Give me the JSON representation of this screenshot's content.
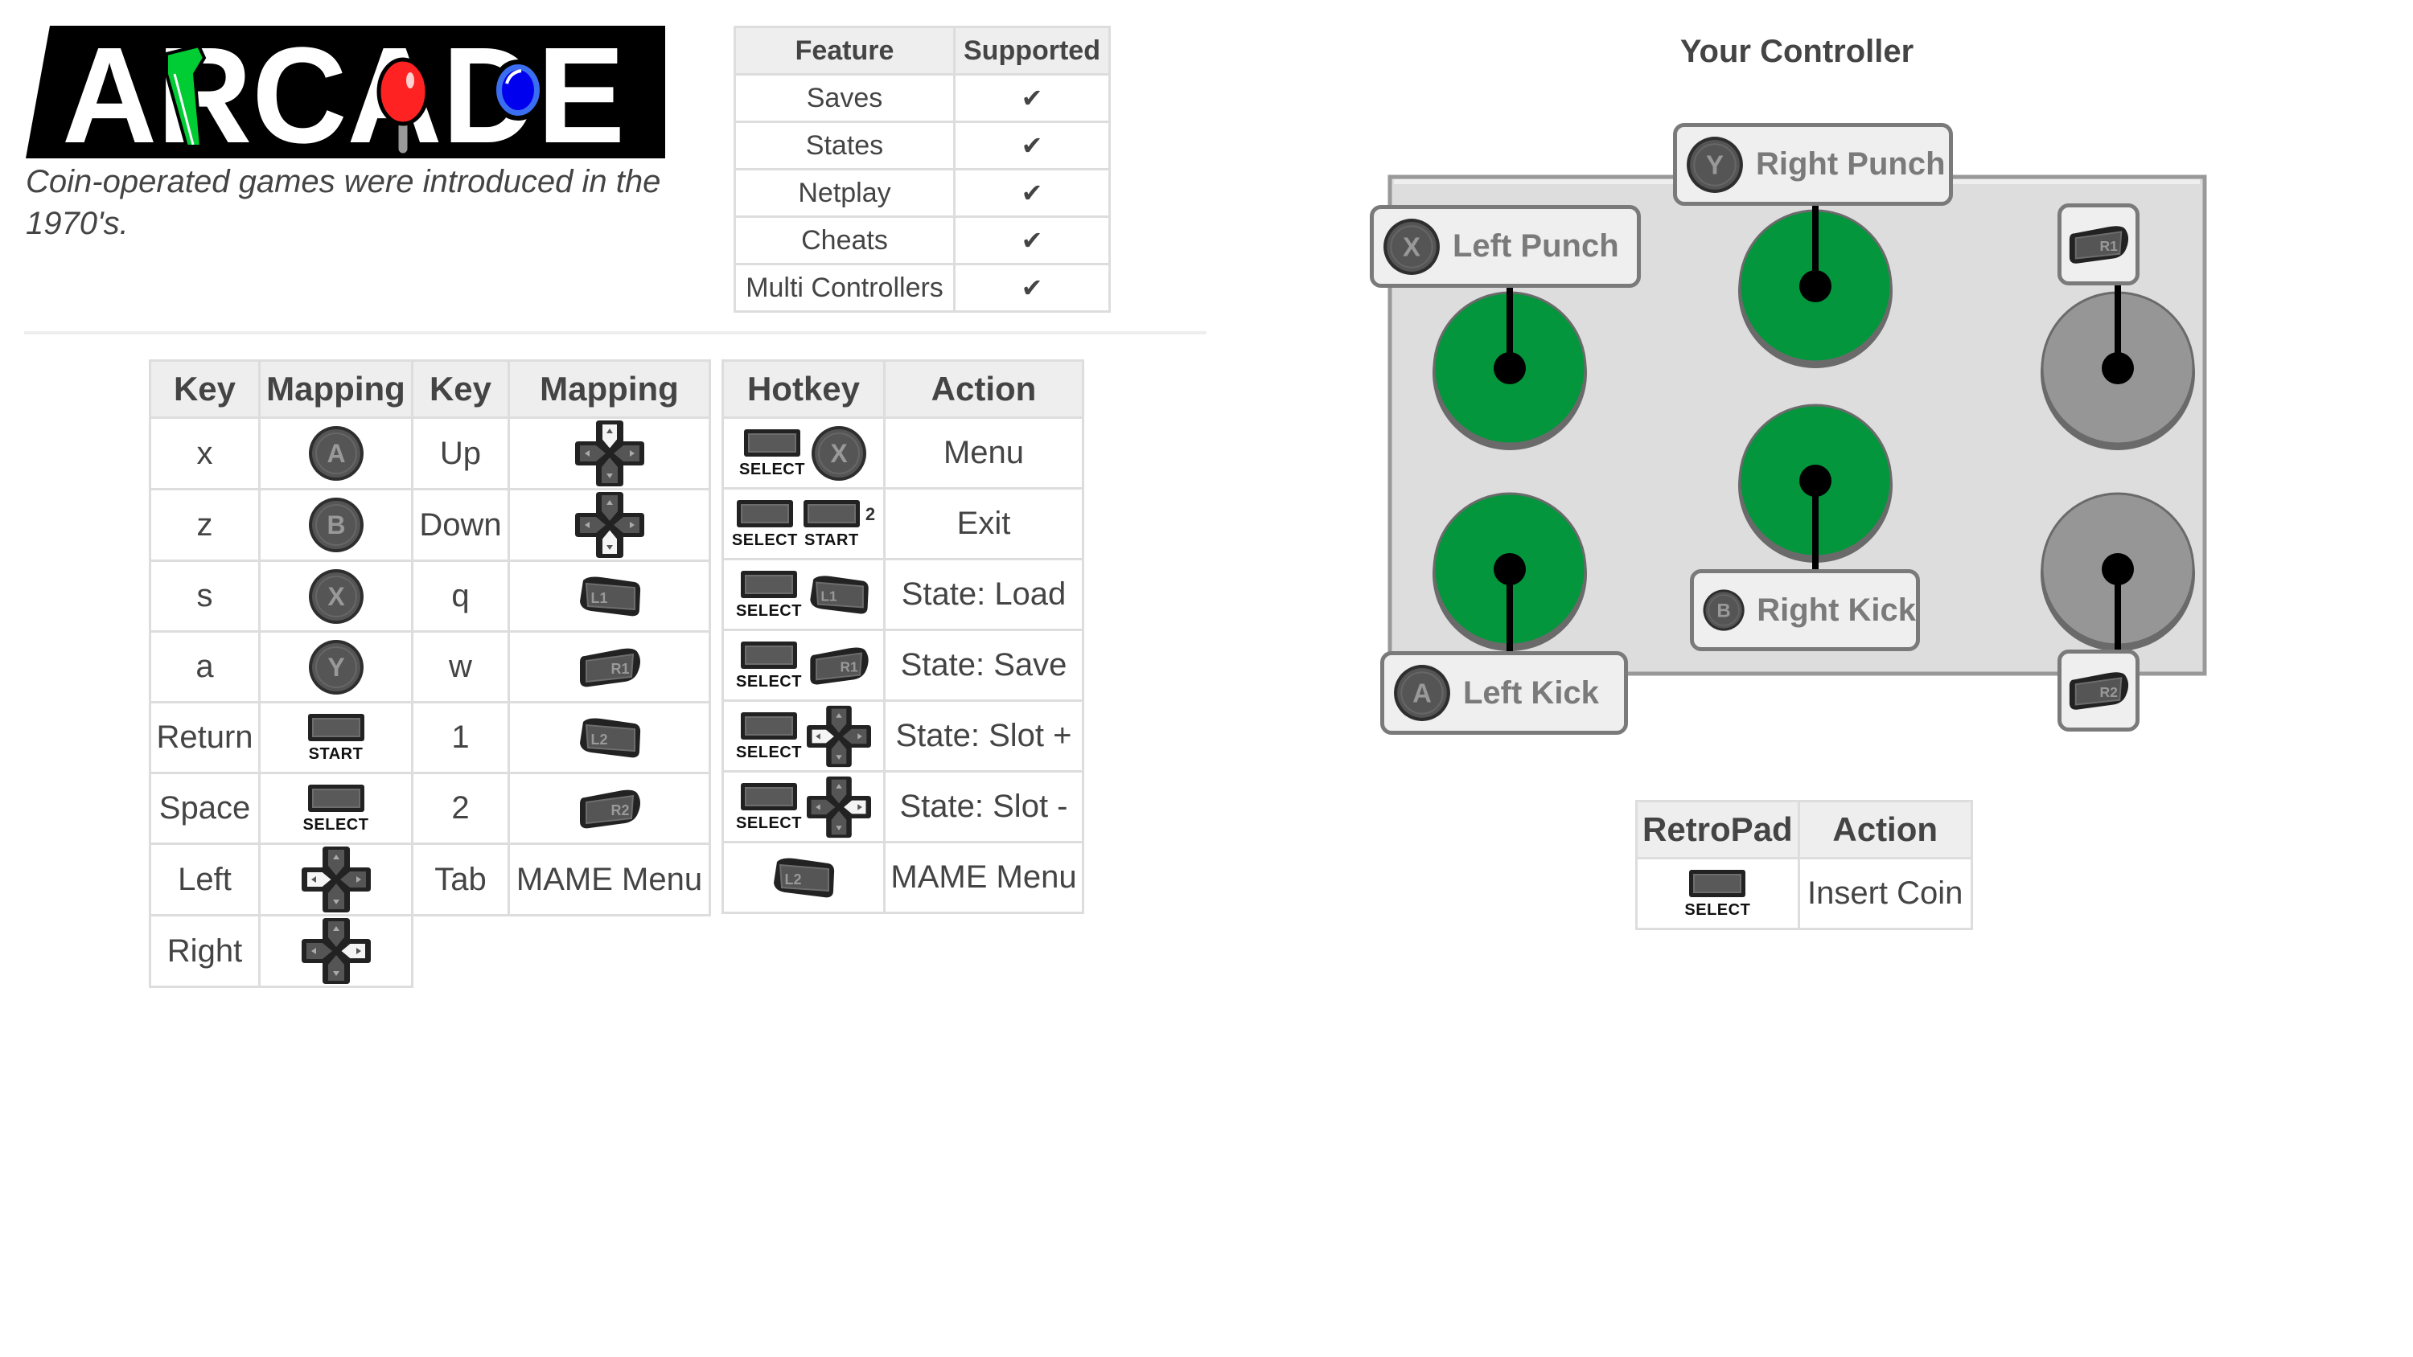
{
  "logo": {
    "text": "ARCADE",
    "colors": {
      "bg": "#000000",
      "letters": "#ffffff",
      "green": "#00cc33",
      "red_ball": "#ff2222",
      "blue_button": "#0000ee"
    }
  },
  "tagline": "Coin-operated games were introduced in the 1970's.",
  "features": {
    "headers": [
      "Feature",
      "Supported"
    ],
    "rows": [
      {
        "feature": "Saves",
        "supported": "✔"
      },
      {
        "feature": "States",
        "supported": "✔"
      },
      {
        "feature": "Netplay",
        "supported": "✔"
      },
      {
        "feature": "Cheats",
        "supported": "✔"
      },
      {
        "feature": "Multi Controllers",
        "supported": "✔"
      }
    ]
  },
  "key_mappings": {
    "headers": [
      "Key",
      "Mapping",
      "Key",
      "Mapping"
    ],
    "left": [
      {
        "key": "x",
        "mapping": "A",
        "icon": "a-button-icon"
      },
      {
        "key": "z",
        "mapping": "B",
        "icon": "b-button-icon"
      },
      {
        "key": "s",
        "mapping": "X",
        "icon": "x-button-icon"
      },
      {
        "key": "a",
        "mapping": "Y",
        "icon": "y-button-icon"
      },
      {
        "key": "Return",
        "mapping": "START",
        "icon": "start-button-icon"
      },
      {
        "key": "Space",
        "mapping": "SELECT",
        "icon": "select-button-icon"
      },
      {
        "key": "Left",
        "mapping": "D-Pad Left",
        "icon": "dpad-left-icon"
      },
      {
        "key": "Right",
        "mapping": "D-Pad Right",
        "icon": "dpad-right-icon"
      }
    ],
    "right": [
      {
        "key": "Up",
        "mapping": "D-Pad Up",
        "icon": "dpad-up-icon"
      },
      {
        "key": "Down",
        "mapping": "D-Pad Down",
        "icon": "dpad-down-icon"
      },
      {
        "key": "q",
        "mapping": "L1",
        "icon": "l1-button-icon"
      },
      {
        "key": "w",
        "mapping": "R1",
        "icon": "r1-button-icon"
      },
      {
        "key": "1",
        "mapping": "L2",
        "icon": "l2-button-icon"
      },
      {
        "key": "2",
        "mapping": "R2",
        "icon": "r2-button-icon"
      },
      {
        "key": "Tab",
        "mapping": "MAME Menu",
        "icon": null
      }
    ]
  },
  "hotkeys": {
    "headers": [
      "Hotkey",
      "Action"
    ],
    "rows": [
      {
        "combo": [
          "SELECT",
          "X"
        ],
        "action": "Menu"
      },
      {
        "combo": [
          "SELECT",
          "START"
        ],
        "superscript": "2",
        "action": "Exit"
      },
      {
        "combo": [
          "SELECT",
          "L1"
        ],
        "action": "State: Load"
      },
      {
        "combo": [
          "SELECT",
          "R1"
        ],
        "action": "State: Save"
      },
      {
        "combo": [
          "SELECT",
          "D-Pad Left"
        ],
        "action": "State: Slot +"
      },
      {
        "combo": [
          "SELECT",
          "D-Pad Right"
        ],
        "action": "State: Slot -"
      },
      {
        "combo": [
          "L2"
        ],
        "action": "MAME Menu"
      }
    ]
  },
  "controller": {
    "title": "Your Controller",
    "colors": {
      "active": "#03963c",
      "inactive": "#969696",
      "panel": "#dddddd"
    },
    "labels": [
      {
        "button": "X",
        "text": "Left Punch"
      },
      {
        "button": "Y",
        "text": "Right Punch"
      },
      {
        "button": "R1",
        "text": ""
      },
      {
        "button": "A",
        "text": "Left Kick"
      },
      {
        "button": "B",
        "text": "Right Kick"
      },
      {
        "button": "R2",
        "text": ""
      }
    ],
    "buttons": [
      {
        "name": "left-punch",
        "state": "active"
      },
      {
        "name": "right-punch",
        "state": "active"
      },
      {
        "name": "r1",
        "state": "inactive"
      },
      {
        "name": "left-kick",
        "state": "active"
      },
      {
        "name": "right-kick",
        "state": "active"
      },
      {
        "name": "r2",
        "state": "inactive"
      }
    ]
  },
  "retropad": {
    "headers": [
      "RetroPad",
      "Action"
    ],
    "rows": [
      {
        "retropad": "SELECT",
        "action": "Insert Coin"
      }
    ]
  },
  "system_button_labels": {
    "start": "START",
    "select": "SELECT"
  },
  "face_letters": {
    "a": "A",
    "b": "B",
    "x": "X",
    "y": "Y"
  },
  "shoulder_letters": {
    "l1": "L1",
    "r1": "R1",
    "l2": "L2",
    "r2": "R2"
  }
}
